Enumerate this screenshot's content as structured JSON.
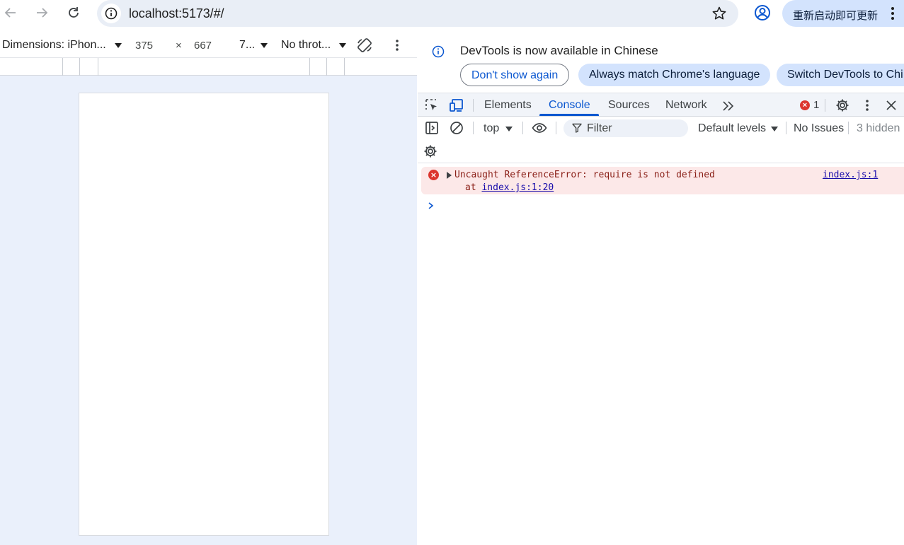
{
  "browser": {
    "url": "localhost:5173/#/",
    "update_button": "重新启动即可更新"
  },
  "device_toolbar": {
    "dimensions": "Dimensions: iPhon...",
    "width": "375",
    "times": "×",
    "height": "667",
    "zoom": "7...",
    "throttle": "No throt..."
  },
  "infobar": {
    "message": "DevTools is now available in Chinese",
    "buttons": [
      "Don't show again",
      "Always match Chrome's language",
      "Switch DevTools to Chi"
    ]
  },
  "tabs": {
    "items": [
      "Elements",
      "Console",
      "Sources",
      "Network"
    ],
    "active": "Console",
    "error_count": "1"
  },
  "console_toolbar": {
    "context": "top",
    "filter_placeholder": "Filter",
    "levels": "Default levels",
    "issues": "No Issues",
    "hidden": "3 hidden"
  },
  "messages": [
    {
      "level": "error",
      "text": "Uncaught ReferenceError: require is not defined",
      "stack_prefix": "at ",
      "stack_link": "index.js:1:20",
      "source": "index.js:1"
    }
  ],
  "colors": {
    "accent": "#0b57d0",
    "error": "#dc362e",
    "error_bg": "#fce8e8",
    "pill": "#d3e3fd"
  }
}
